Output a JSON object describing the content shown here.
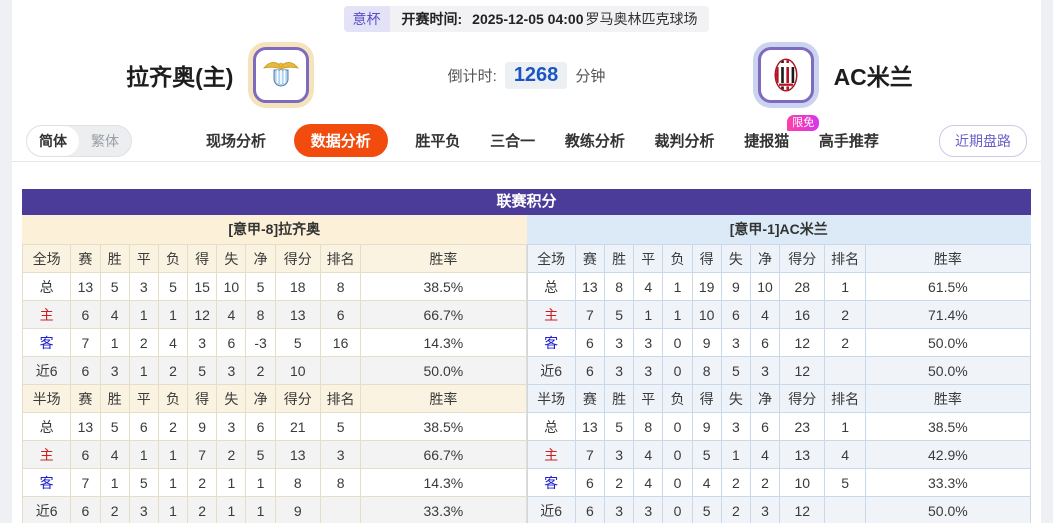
{
  "top_bar": {
    "league_badge": "意杯",
    "kickoff_label": "开赛时间:",
    "kickoff_time": "2025-12-05 04:00",
    "venue": "罗马奥林匹克球场"
  },
  "header": {
    "home_team": "拉齐奥(主)",
    "away_team": "AC米兰",
    "home_logo": "lazio-crest",
    "away_logo": "ac-milan-crest",
    "countdown_label": "倒计时:",
    "countdown_value": "1268",
    "countdown_unit": "分钟"
  },
  "nav": {
    "lang_options": [
      {
        "label": "简体",
        "active": true
      },
      {
        "label": "繁体",
        "active": false
      }
    ],
    "tabs": [
      {
        "id": "live-analysis",
        "label": "现场分析",
        "active": false
      },
      {
        "id": "data-analysis",
        "label": "数据分析",
        "active": true
      },
      {
        "id": "win-draw-lose",
        "label": "胜平负",
        "active": false
      },
      {
        "id": "three-in-one",
        "label": "三合一",
        "active": false
      },
      {
        "id": "coach-analysis",
        "label": "教练分析",
        "active": false
      },
      {
        "id": "referee-analysis",
        "label": "裁判分析",
        "active": false
      },
      {
        "id": "jiebao-cat",
        "label": "捷报猫",
        "active": false,
        "badge": "限免"
      },
      {
        "id": "expert-picks",
        "label": "高手推荐",
        "active": false
      }
    ],
    "right_button": "近期盘路"
  },
  "standings": {
    "title": "联赛积分",
    "teams": [
      {
        "name": "[意甲-8]拉齐奥",
        "theme": "cream",
        "sections": [
          {
            "label": "全场",
            "columns": [
              "赛",
              "胜",
              "平",
              "负",
              "得",
              "失",
              "净",
              "得分",
              "排名",
              "胜率"
            ],
            "rows": [
              {
                "type": "total",
                "label": "总",
                "values": [
                  "13",
                  "5",
                  "3",
                  "5",
                  "15",
                  "10",
                  "5",
                  "18",
                  "8",
                  "38.5%"
                ]
              },
              {
                "type": "home",
                "label": "主",
                "values": [
                  "6",
                  "4",
                  "1",
                  "1",
                  "12",
                  "4",
                  "8",
                  "13",
                  "6",
                  "66.7%"
                ]
              },
              {
                "type": "away",
                "label": "客",
                "values": [
                  "7",
                  "1",
                  "2",
                  "4",
                  "3",
                  "6",
                  "-3",
                  "5",
                  "16",
                  "14.3%"
                ]
              },
              {
                "type": "last6",
                "label": "近6",
                "values": [
                  "6",
                  "3",
                  "1",
                  "2",
                  "5",
                  "3",
                  "2",
                  "10",
                  "",
                  "50.0%"
                ]
              }
            ]
          },
          {
            "label": "半场",
            "columns": [
              "赛",
              "胜",
              "平",
              "负",
              "得",
              "失",
              "净",
              "得分",
              "排名",
              "胜率"
            ],
            "rows": [
              {
                "type": "total",
                "label": "总",
                "values": [
                  "13",
                  "5",
                  "6",
                  "2",
                  "9",
                  "3",
                  "6",
                  "21",
                  "5",
                  "38.5%"
                ]
              },
              {
                "type": "home",
                "label": "主",
                "values": [
                  "6",
                  "4",
                  "1",
                  "1",
                  "7",
                  "2",
                  "5",
                  "13",
                  "3",
                  "66.7%"
                ]
              },
              {
                "type": "away",
                "label": "客",
                "values": [
                  "7",
                  "1",
                  "5",
                  "1",
                  "2",
                  "1",
                  "1",
                  "8",
                  "8",
                  "14.3%"
                ]
              },
              {
                "type": "last6",
                "label": "近6",
                "values": [
                  "6",
                  "2",
                  "3",
                  "1",
                  "2",
                  "1",
                  "1",
                  "9",
                  "",
                  "33.3%"
                ]
              }
            ]
          }
        ]
      },
      {
        "name": "[意甲-1]AC米兰",
        "theme": "blue",
        "sections": [
          {
            "label": "全场",
            "columns": [
              "赛",
              "胜",
              "平",
              "负",
              "得",
              "失",
              "净",
              "得分",
              "排名",
              "胜率"
            ],
            "rows": [
              {
                "type": "total",
                "label": "总",
                "values": [
                  "13",
                  "8",
                  "4",
                  "1",
                  "19",
                  "9",
                  "10",
                  "28",
                  "1",
                  "61.5%"
                ]
              },
              {
                "type": "home",
                "label": "主",
                "values": [
                  "7",
                  "5",
                  "1",
                  "1",
                  "10",
                  "6",
                  "4",
                  "16",
                  "2",
                  "71.4%"
                ]
              },
              {
                "type": "away",
                "label": "客",
                "values": [
                  "6",
                  "3",
                  "3",
                  "0",
                  "9",
                  "3",
                  "6",
                  "12",
                  "2",
                  "50.0%"
                ]
              },
              {
                "type": "last6",
                "label": "近6",
                "values": [
                  "6",
                  "3",
                  "3",
                  "0",
                  "8",
                  "5",
                  "3",
                  "12",
                  "",
                  "50.0%"
                ]
              }
            ]
          },
          {
            "label": "半场",
            "columns": [
              "赛",
              "胜",
              "平",
              "负",
              "得",
              "失",
              "净",
              "得分",
              "排名",
              "胜率"
            ],
            "rows": [
              {
                "type": "total",
                "label": "总",
                "values": [
                  "13",
                  "5",
                  "8",
                  "0",
                  "9",
                  "3",
                  "6",
                  "23",
                  "1",
                  "38.5%"
                ]
              },
              {
                "type": "home",
                "label": "主",
                "values": [
                  "7",
                  "3",
                  "4",
                  "0",
                  "5",
                  "1",
                  "4",
                  "13",
                  "4",
                  "42.9%"
                ]
              },
              {
                "type": "away",
                "label": "客",
                "values": [
                  "6",
                  "2",
                  "4",
                  "0",
                  "4",
                  "2",
                  "2",
                  "10",
                  "5",
                  "33.3%"
                ]
              },
              {
                "type": "last6",
                "label": "近6",
                "values": [
                  "6",
                  "3",
                  "3",
                  "0",
                  "5",
                  "2",
                  "3",
                  "12",
                  "",
                  "50.0%"
                ]
              }
            ]
          }
        ]
      }
    ]
  },
  "colors": {
    "accent_purple": "#4c3c99",
    "active_tab_orange": "#f14b0e",
    "home_band_cream": "#fcf1d8",
    "away_band_blue": "#dbeaf6",
    "home_row_label_red": "#cc2020",
    "away_row_label_blue": "#2020cc",
    "countdown_blue": "#1b55c3",
    "badge_pink": "#ff3fa6"
  }
}
